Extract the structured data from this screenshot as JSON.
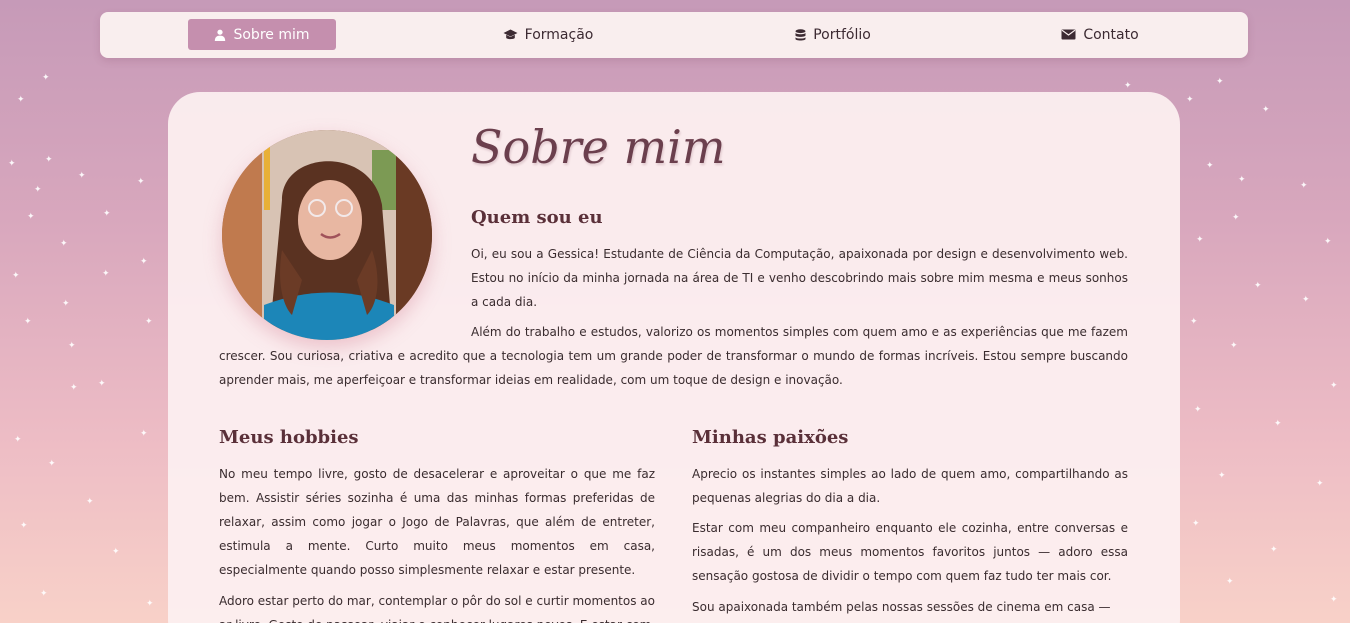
{
  "nav": {
    "items": [
      {
        "label": "Sobre mim",
        "icon": "user-icon",
        "active": true
      },
      {
        "label": "Formação",
        "icon": "graduation-cap-icon",
        "active": false
      },
      {
        "label": "Portfólio",
        "icon": "database-icon",
        "active": false
      },
      {
        "label": "Contato",
        "icon": "envelope-icon",
        "active": false
      }
    ]
  },
  "main": {
    "title": "Sobre mim",
    "profile_photo": "profile-photo",
    "about": {
      "heading": "Quem sou eu",
      "paragraph1": "Oi, eu sou a Gessica! Estudante de Ciência da Computação, apaixonada por design e desenvolvimento web. Estou no início da minha jornada na área de TI e venho descobrindo mais sobre mim mesma e meus sonhos a cada dia.",
      "paragraph2": "Além do trabalho e estudos, valorizo os momentos simples com quem amo e as experiências que me fazem crescer. Sou curiosa, criativa e acredito que a tecnologia tem um grande poder de transformar o mundo de formas incríveis. Estou sempre buscando aprender mais, me aperfeiçoar e transformar ideias em realidade, com um toque de design e inovação."
    },
    "hobbies": {
      "heading": "Meus hobbies",
      "paragraph1": "No meu tempo livre, gosto de desacelerar e aproveitar o que me faz bem. Assistir séries sozinha é uma das minhas formas preferidas de relaxar, assim como jogar o Jogo de Palavras, que além de entreter, estimula a mente. Curto muito meus momentos em casa, especialmente quando posso simplesmente relaxar e estar presente.",
      "paragraph2": "Adoro estar perto do mar, contemplar o pôr do sol e curtir momentos ao ar livre. Gosto de passear, viajar e conhecer lugares novos. E estar com"
    },
    "passions": {
      "heading": "Minhas paixões",
      "paragraph1": "Aprecio os instantes simples ao lado de quem amo, compartilhando as pequenas alegrias do dia a dia.",
      "paragraph2": "Estar com meu companheiro enquanto ele cozinha, entre conversas e risadas, é um dos meus momentos favoritos juntos — adoro essa sensação gostosa de dividir o tempo com quem faz tudo ter mais cor.",
      "paragraph3": "Sou apaixonada também pelas nossas sessões de cinema em casa —"
    }
  },
  "colors": {
    "accent": "#c58fae",
    "heading": "#5a3039",
    "background_top": "#c69ab8",
    "background_bottom": "#f8d1c8"
  }
}
